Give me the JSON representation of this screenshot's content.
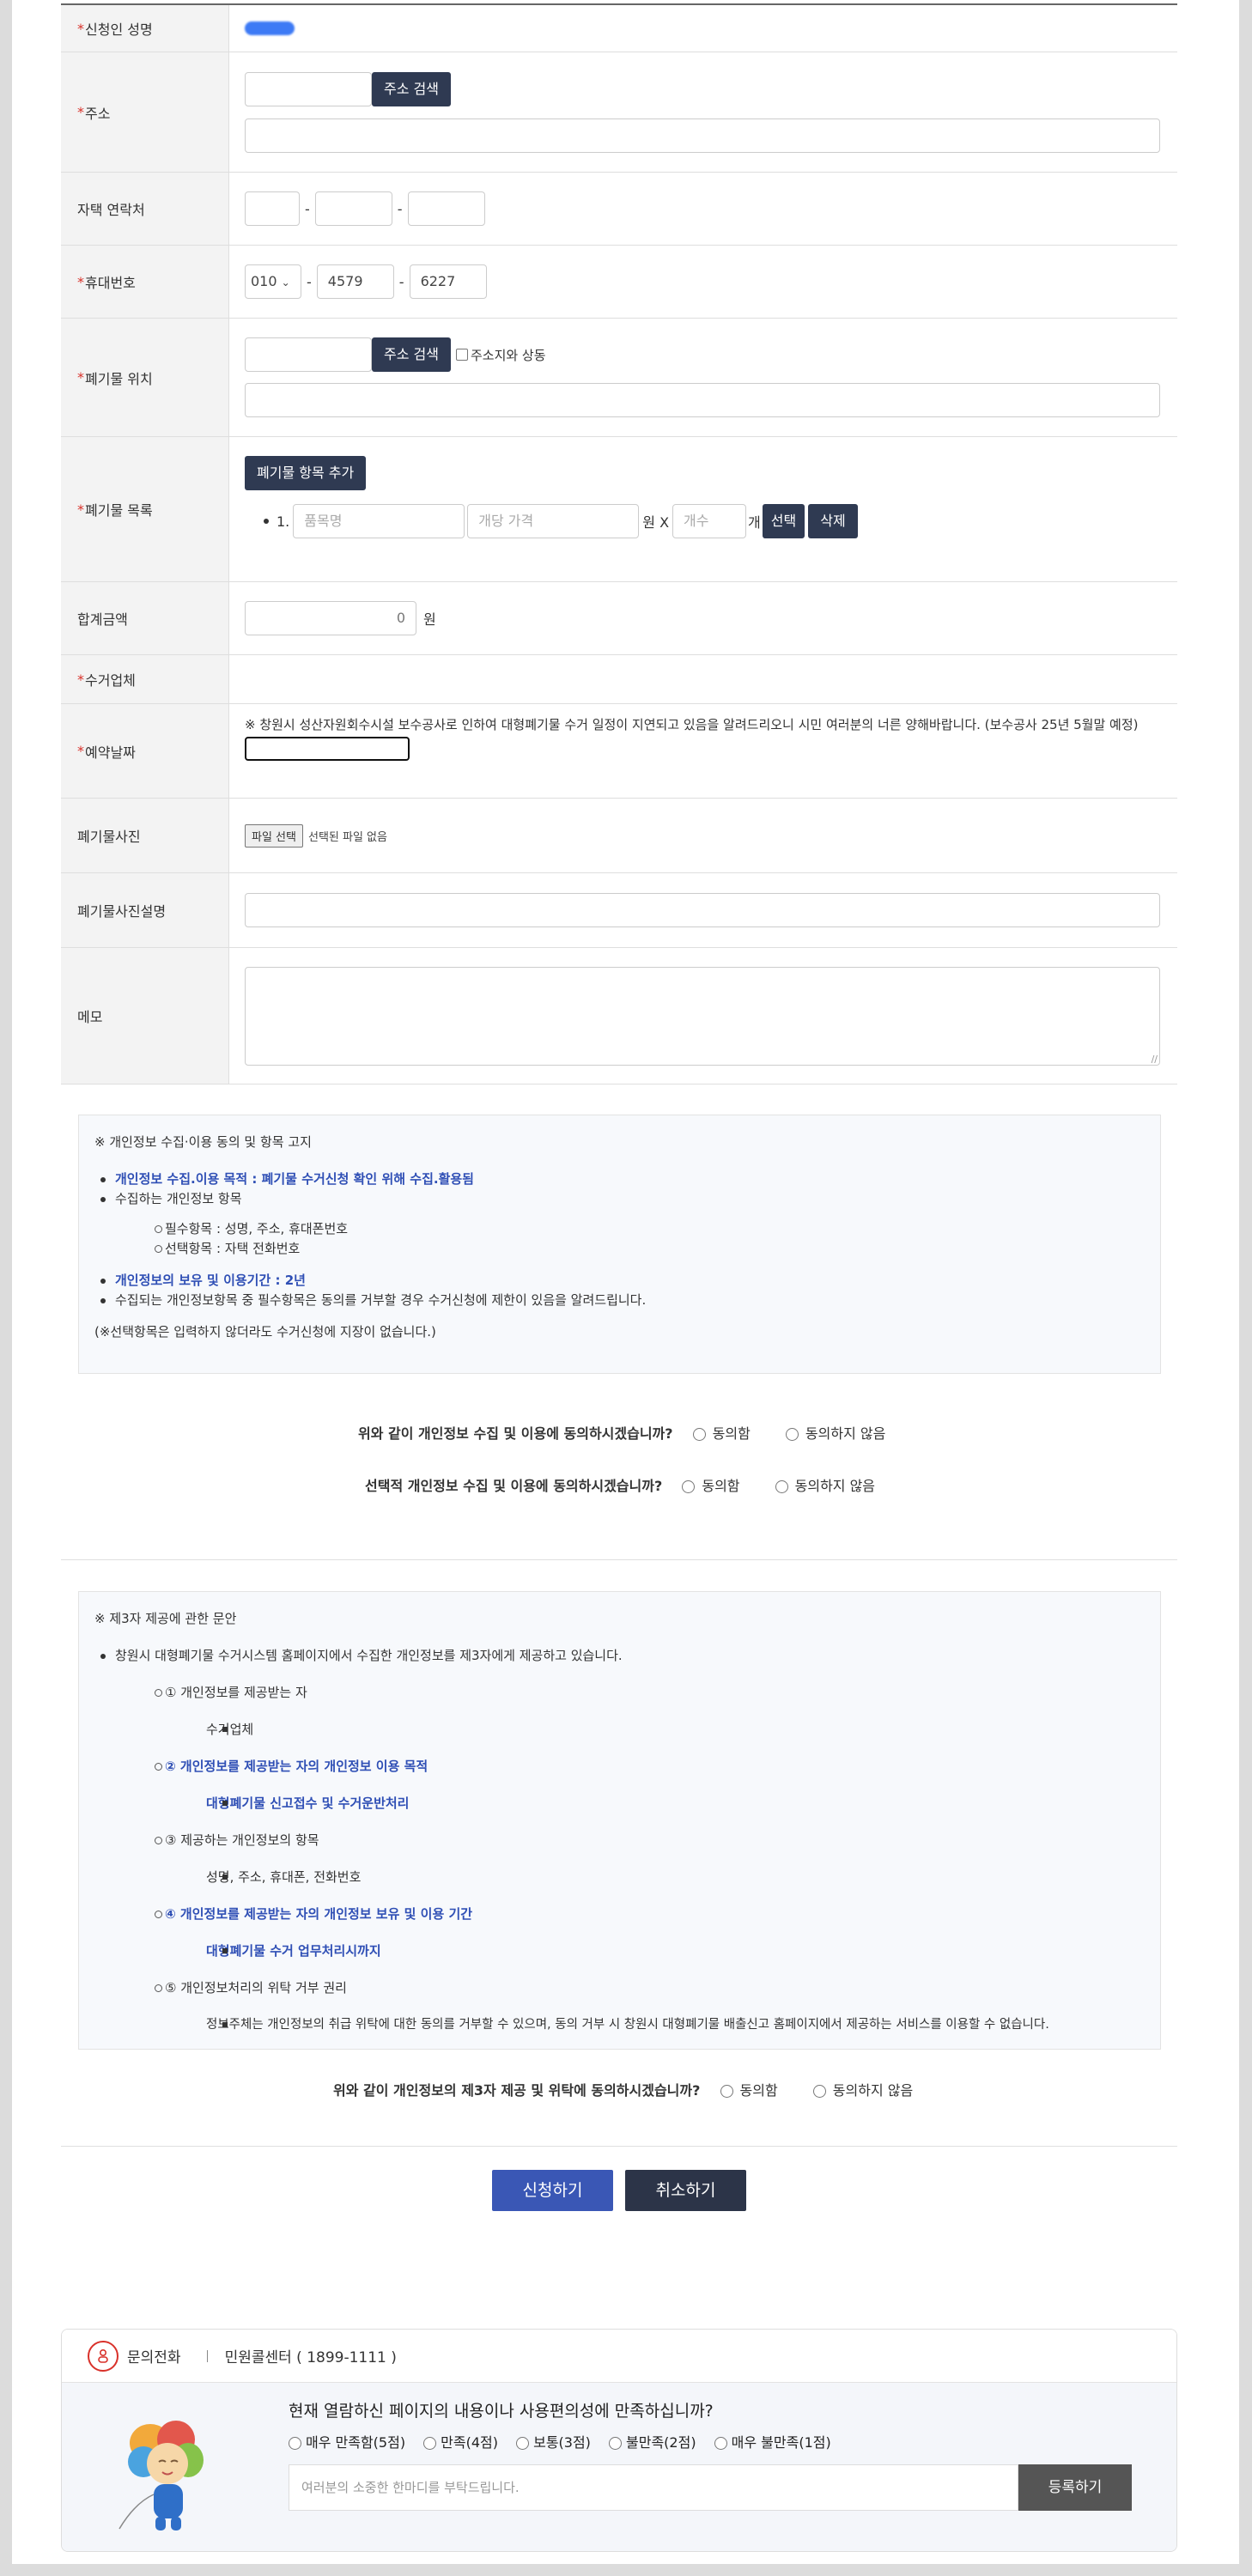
{
  "form": {
    "applicant_label": "신청인 성명",
    "address_label": "주소",
    "address_search_btn": "주소 검색",
    "home_phone_label": "자택 연락처",
    "mobile_label": "휴대번호",
    "mobile_prefix": "010",
    "mobile_mid": "4579",
    "mobile_last": "6227",
    "waste_location_label": "폐기물 위치",
    "waste_search_btn": "주소 검색",
    "same_address_label": "주소지와 상동",
    "waste_list_label": "폐기물 목록",
    "add_item_btn": "폐기물 항목 추가",
    "item_number": "1.",
    "item_name_placeholder": "품목명",
    "item_price_placeholder": "개당 가격",
    "won_x": "원 X",
    "count_placeholder": "개수",
    "count_unit": "개",
    "select_btn": "선택",
    "delete_btn": "삭제",
    "total_label": "합계금액",
    "total_value": "0",
    "total_unit": "원",
    "collector_label": "수거업체",
    "date_label": "예약날짜",
    "date_notice": "※ 창원시 성산자원회수시설 보수공사로 인하여 대형폐기물 수거 일정이 지연되고 있음을 알려드리오니 시민 여러분의 너른 양해바랍니다. (보수공사 25년 5월말 예정)",
    "photo_label": "폐기물사진",
    "file_btn": "파일 선택",
    "file_none": "선택된 파일 없음",
    "photo_desc_label": "폐기물사진설명",
    "memo_label": "메모"
  },
  "privacy": {
    "title": "※ 개인정보 수집·이용 동의 및 항목 고지",
    "purpose": "개인정보 수집.이용 목적 : 폐기물 수거신청 확인 위해 수집.활용됨",
    "items_title": "수집하는 개인정보 항목",
    "required_items": "필수항목 : 성명, 주소, 휴대폰번호",
    "optional_items": "선택항목 : 자택 전화번호",
    "retention": "개인정보의 보유 및 이용기간 : 2년",
    "refuse_notice": "수집되는 개인정보항목 중 필수항목은 동의를 거부할 경우 수거신청에 제한이 있음을 알려드립니다.",
    "optional_note": "(※선택항목은 입력하지 않더라도 수거신청에 지장이 없습니다.)"
  },
  "consent1": {
    "question": "위와 같이 개인정보 수집 및 이용에 동의하시겠습니까?",
    "agree": "동의함",
    "disagree": "동의하지 않음"
  },
  "consent2": {
    "question": "선택적 개인정보 수집 및 이용에 동의하시겠습니까?",
    "agree": "동의함",
    "disagree": "동의하지 않음"
  },
  "third": {
    "title": "※ 제3자 제공에 관한 문안",
    "intro": "창원시 대형폐기물 수거시스템 홈페이지에서 수집한 개인정보를 제3자에게 제공하고 있습니다.",
    "recipient_title": "① 개인정보를 제공받는 자",
    "recipient": "수거업체",
    "purpose_title": "② 개인정보를 제공받는 자의 개인정보 이용 목적",
    "purpose": "대형폐기물 신고접수 및 수거운반처리",
    "items_title": "③ 제공하는 개인정보의 항목",
    "items": "성명, 주소, 휴대폰, 전화번호",
    "period_title": "④ 개인정보를 제공받는 자의 개인정보 보유 및 이용 기간",
    "period": "대형폐기물 수거 업무처리시까지",
    "right_title": "⑤ 개인정보처리의 위탁 거부 권리",
    "right": "정보주체는 개인정보의 취급 위탁에 대한 동의를 거부할 수 있으며, 동의 거부 시 창원시 대형폐기물 배출신고 홈페이지에서 제공하는 서비스를 이용할 수 없습니다."
  },
  "consent3": {
    "question": "위와 같이 개인정보의 제3자 제공 및 위탁에 동의하시겠습니까?",
    "agree": "동의함",
    "disagree": "동의하지 않음"
  },
  "buttons": {
    "submit": "신청하기",
    "cancel": "취소하기",
    "submit_color": "#3a57b5",
    "cancel_color": "#2c3448"
  },
  "footer": {
    "contact_label": "문의전화",
    "center": "민원콜센터 ( 1899-1111 )",
    "survey_question": "현재 열람하신 페이지의 내용이나 사용편의성에 만족하십니까?",
    "options": [
      "매우 만족함(5점)",
      "만족(4점)",
      "보통(3점)",
      "불만족(2점)",
      "매우 불만족(1점)"
    ],
    "comment_placeholder": "여러분의 소중한 한마디를 부탁드립니다.",
    "register_btn": "등록하기"
  }
}
